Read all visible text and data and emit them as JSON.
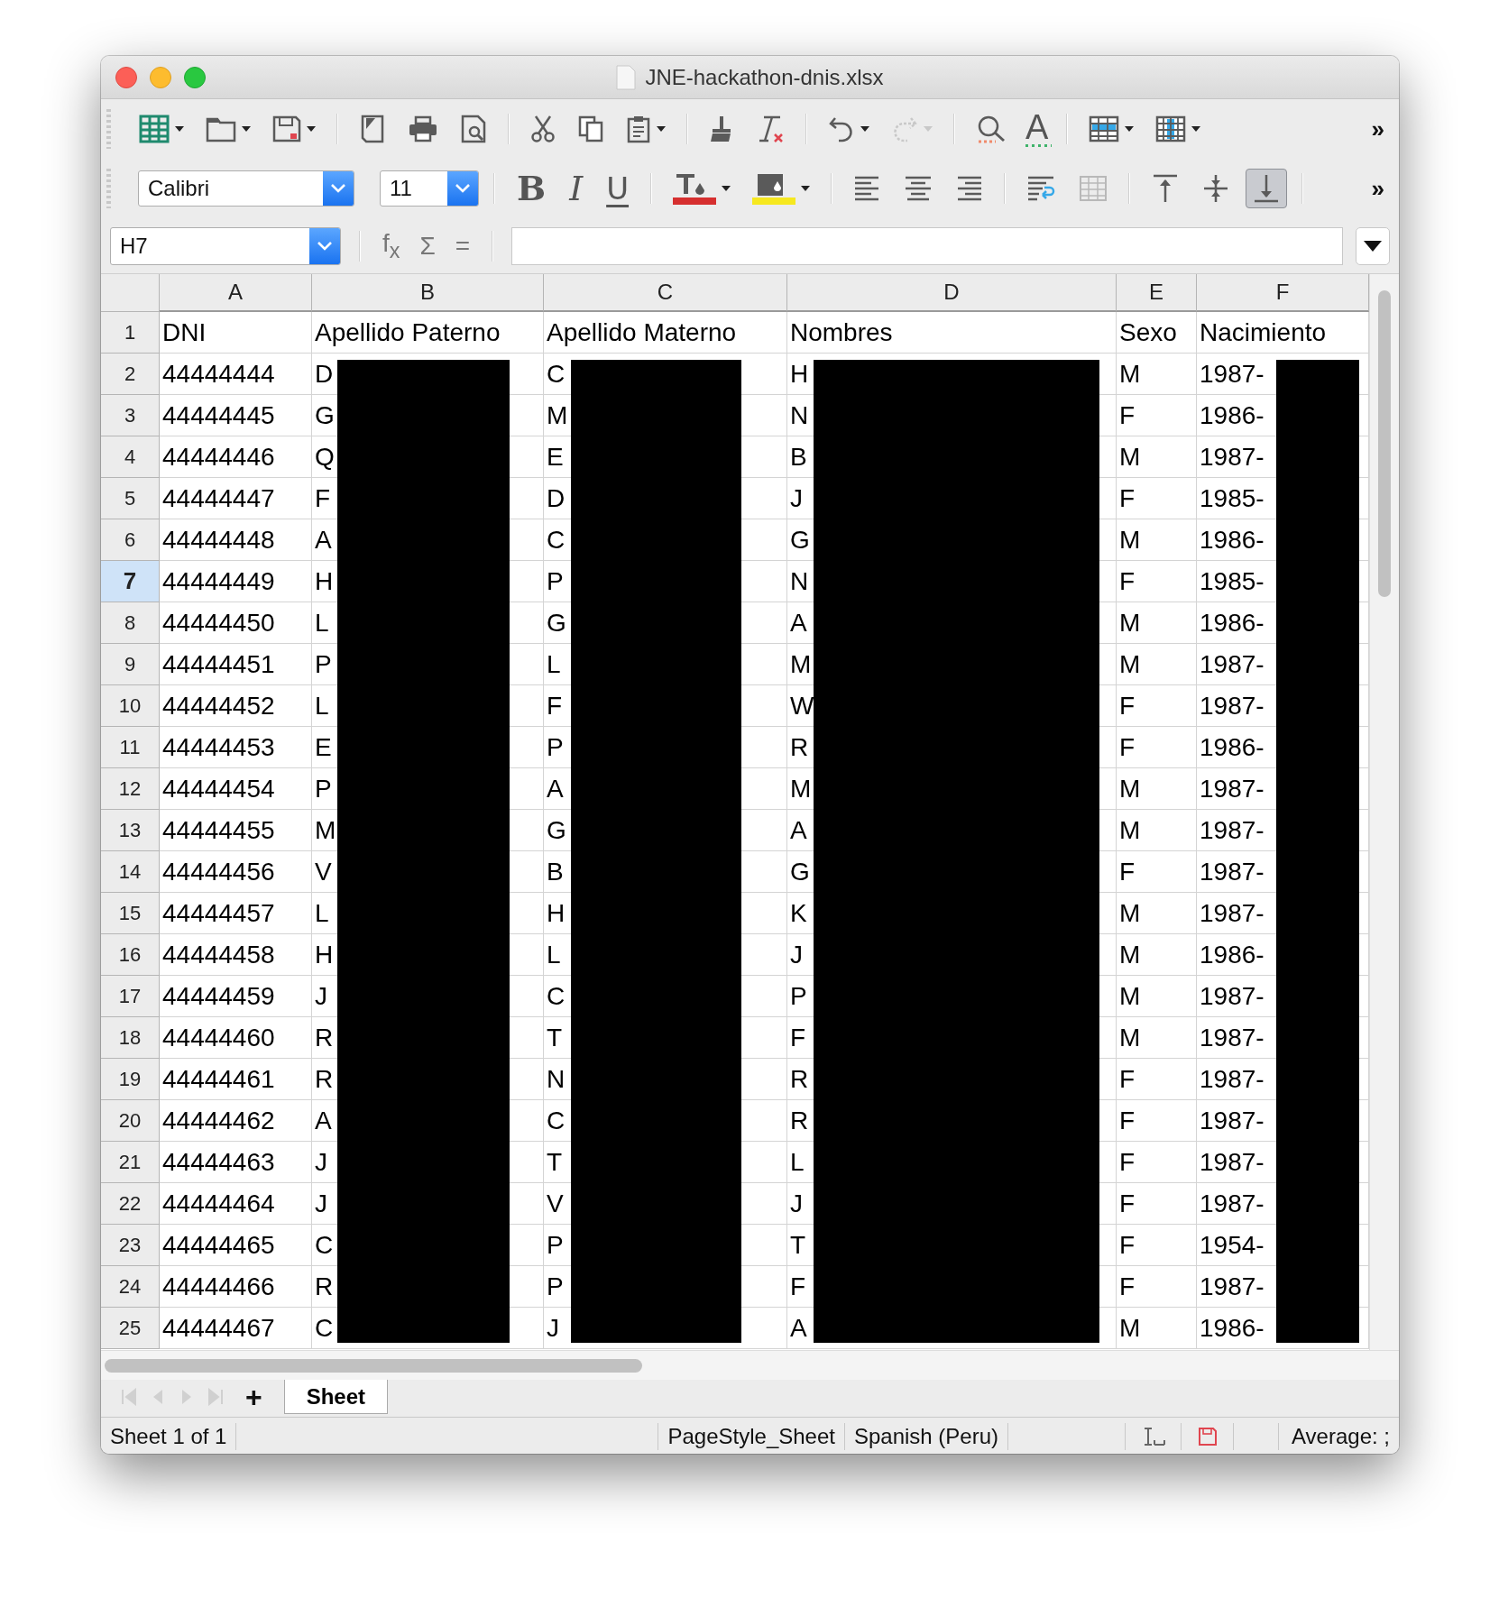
{
  "window": {
    "title": "JNE-hackathon-dnis.xlsx"
  },
  "standard_toolbar": {
    "spelling_label": "A",
    "more": "»",
    "redo_disabled": true
  },
  "formatting_toolbar": {
    "font_name": "Calibri",
    "font_size": "11",
    "bold": "B",
    "italic": "I",
    "underline": "U",
    "more": "»",
    "merge_disabled": true,
    "vertical_align": [
      {
        "selected": false
      },
      {
        "selected": false
      },
      {
        "selected": true
      }
    ]
  },
  "formula_bar": {
    "name_box": "H7",
    "function_wizard": "f$_{x}$",
    "sum": "Σ",
    "equals": "="
  },
  "sheet": {
    "columns": [
      "A",
      "B",
      "C",
      "D",
      "E",
      "F"
    ],
    "rows": [
      {
        "number": "1",
        "selected": false,
        "cells": [
          "DNI",
          "Apellido Paterno",
          "Apellido Materno",
          "Nombres",
          "Sexo",
          "Nacimiento"
        ]
      },
      {
        "number": "2",
        "selected": false,
        "cells": [
          "44444444",
          "D",
          "C",
          "H",
          "M",
          "1987-"
        ]
      },
      {
        "number": "3",
        "selected": false,
        "cells": [
          "44444445",
          "G",
          "M",
          "N",
          "F",
          "1986-"
        ]
      },
      {
        "number": "4",
        "selected": false,
        "cells": [
          "44444446",
          "Q",
          "E",
          "B",
          "M",
          "1987-"
        ]
      },
      {
        "number": "5",
        "selected": false,
        "cells": [
          "44444447",
          "F",
          "D",
          "J",
          "F",
          "1985-"
        ]
      },
      {
        "number": "6",
        "selected": false,
        "cells": [
          "44444448",
          "A",
          "C",
          "G",
          "M",
          "1986-"
        ]
      },
      {
        "number": "7",
        "selected": true,
        "cells": [
          "44444449",
          "H",
          "P",
          "N",
          "F",
          "1985-"
        ]
      },
      {
        "number": "8",
        "selected": false,
        "cells": [
          "44444450",
          "L",
          "G",
          "A",
          "M",
          "1986-"
        ]
      },
      {
        "number": "9",
        "selected": false,
        "cells": [
          "44444451",
          "P",
          "L",
          "M",
          "M",
          "1987-"
        ]
      },
      {
        "number": "10",
        "selected": false,
        "cells": [
          "44444452",
          "L",
          "F",
          "W",
          "F",
          "1987-"
        ]
      },
      {
        "number": "11",
        "selected": false,
        "cells": [
          "44444453",
          "E",
          "P",
          "R",
          "F",
          "1986-"
        ]
      },
      {
        "number": "12",
        "selected": false,
        "cells": [
          "44444454",
          "P",
          "A",
          "M",
          "M",
          "1987-"
        ]
      },
      {
        "number": "13",
        "selected": false,
        "cells": [
          "44444455",
          "M",
          "G",
          "A",
          "M",
          "1987-"
        ]
      },
      {
        "number": "14",
        "selected": false,
        "cells": [
          "44444456",
          "V",
          "B",
          "G",
          "F",
          "1987-"
        ]
      },
      {
        "number": "15",
        "selected": false,
        "cells": [
          "44444457",
          "L",
          "H",
          "K",
          "M",
          "1987-"
        ]
      },
      {
        "number": "16",
        "selected": false,
        "cells": [
          "44444458",
          "H",
          "L",
          "J",
          "M",
          "1986-"
        ]
      },
      {
        "number": "17",
        "selected": false,
        "cells": [
          "44444459",
          "J",
          "C",
          "P",
          "M",
          "1987-"
        ]
      },
      {
        "number": "18",
        "selected": false,
        "cells": [
          "44444460",
          "R",
          "T",
          "F",
          "M",
          "1987-"
        ]
      },
      {
        "number": "19",
        "selected": false,
        "cells": [
          "44444461",
          "R",
          "N",
          "R",
          "F",
          "1987-"
        ]
      },
      {
        "number": "20",
        "selected": false,
        "cells": [
          "44444462",
          "A",
          "C",
          "R",
          "F",
          "1987-"
        ]
      },
      {
        "number": "21",
        "selected": false,
        "cells": [
          "44444463",
          "J",
          "T",
          "L",
          "F",
          "1987-"
        ]
      },
      {
        "number": "22",
        "selected": false,
        "cells": [
          "44444464",
          "J",
          "V",
          "J",
          "F",
          "1987-"
        ]
      },
      {
        "number": "23",
        "selected": false,
        "cells": [
          "44444465",
          "C",
          "P",
          "T",
          "F",
          "1954-"
        ]
      },
      {
        "number": "24",
        "selected": false,
        "cells": [
          "44444466",
          "R",
          "P",
          "F",
          "F",
          "1987-"
        ]
      },
      {
        "number": "25",
        "selected": false,
        "cells": [
          "44444467",
          "C",
          "J",
          "A",
          "M",
          "1986-"
        ]
      }
    ]
  },
  "sheet_tabs": {
    "add": "+",
    "tabs": [
      {
        "label": "Sheet",
        "selected": true
      }
    ]
  },
  "status_bar": {
    "sheet_position": "Sheet 1 of 1",
    "page_style": "PageStyle_Sheet",
    "language": "Spanish (Peru)",
    "summary": "Average: ;"
  }
}
